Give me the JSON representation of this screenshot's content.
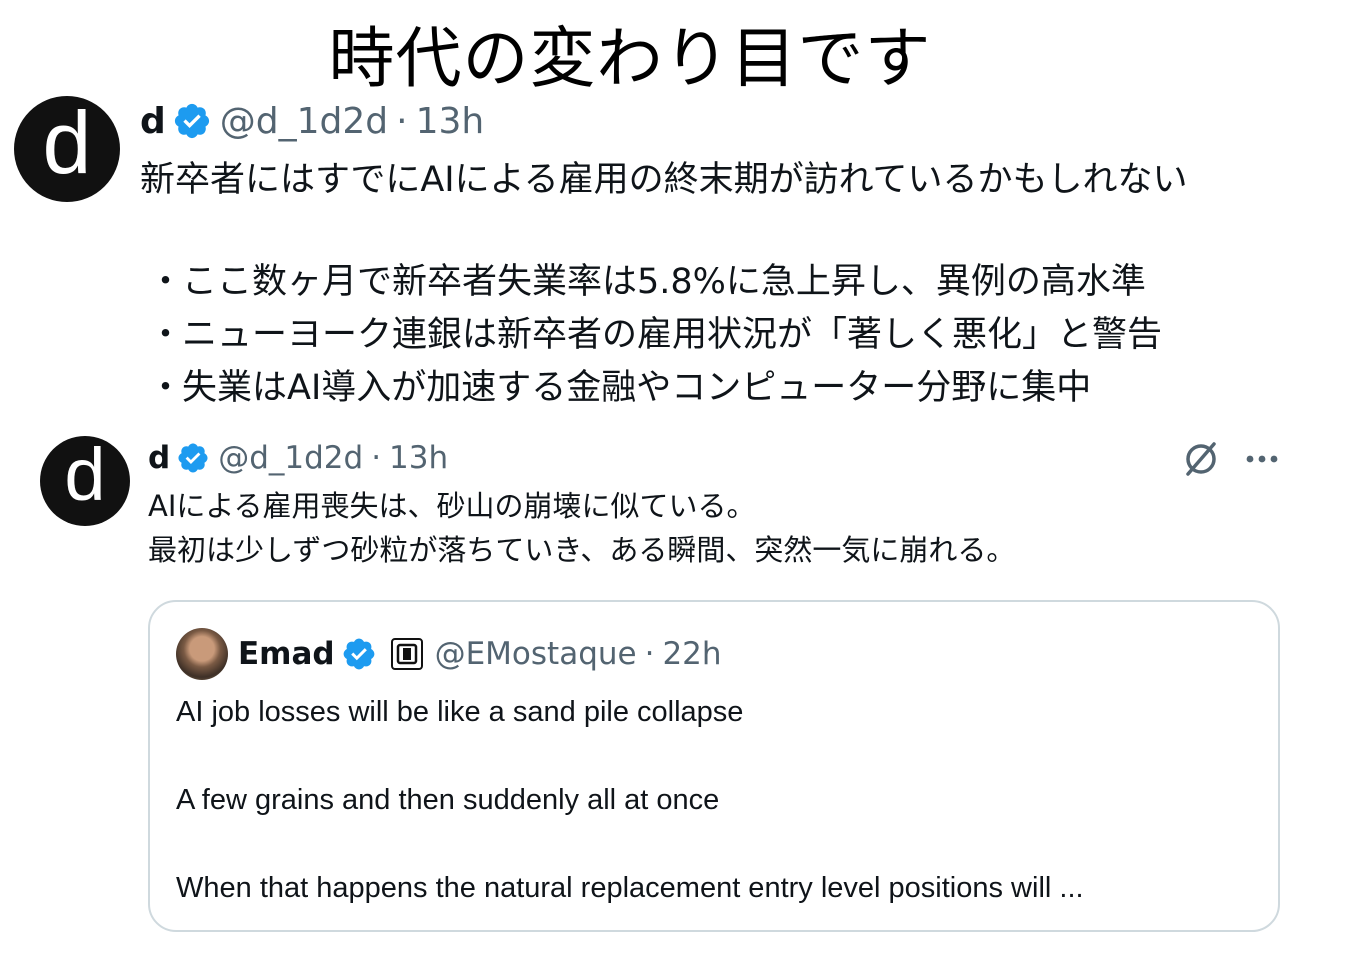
{
  "caption": "時代の変わり目です",
  "tweet1": {
    "avatar_letter": "d",
    "name": "d",
    "handle": "@d_1d2d",
    "separator": "·",
    "time": "13h",
    "text": "新卒者にはすでにAIによる雇用の終末期が訪れているかもしれない",
    "bullet_marker": "・",
    "bullets": [
      "ここ数ヶ月で新卒者失業率は5.8%に急上昇し、異例の高水準",
      "ニューヨーク連銀は新卒者の雇用状況が「著しく悪化」と警告",
      "失業はAI導入が加速する金融やコンピューター分野に集中"
    ]
  },
  "tweet2": {
    "avatar_letter": "d",
    "name": "d",
    "handle": "@d_1d2d",
    "separator": "·",
    "time": "13h",
    "lines": [
      "AIによる雇用喪失は、砂山の崩壊に似ている。",
      "最初は少しずつ砂粒が落ちていき、ある瞬間、突然一気に崩れる。"
    ],
    "more_label": "···"
  },
  "quote": {
    "name": "Emad",
    "handle": "@EMostaque",
    "separator": "·",
    "time": "22h",
    "lines": [
      "AI job losses will be like a sand pile collapse",
      "A few grains and then suddenly all at once",
      "When that happens the natural replacement entry level positions will ..."
    ]
  },
  "icons": {
    "verified": "verified-badge-icon",
    "grok": "grok-icon",
    "more": "more-icon",
    "affiliate": "affiliate-badge-icon"
  },
  "colors": {
    "verified_blue": "#1d9bf0",
    "secondary_text": "#536471",
    "primary_text": "#0f1419",
    "border": "#cfd9de"
  }
}
